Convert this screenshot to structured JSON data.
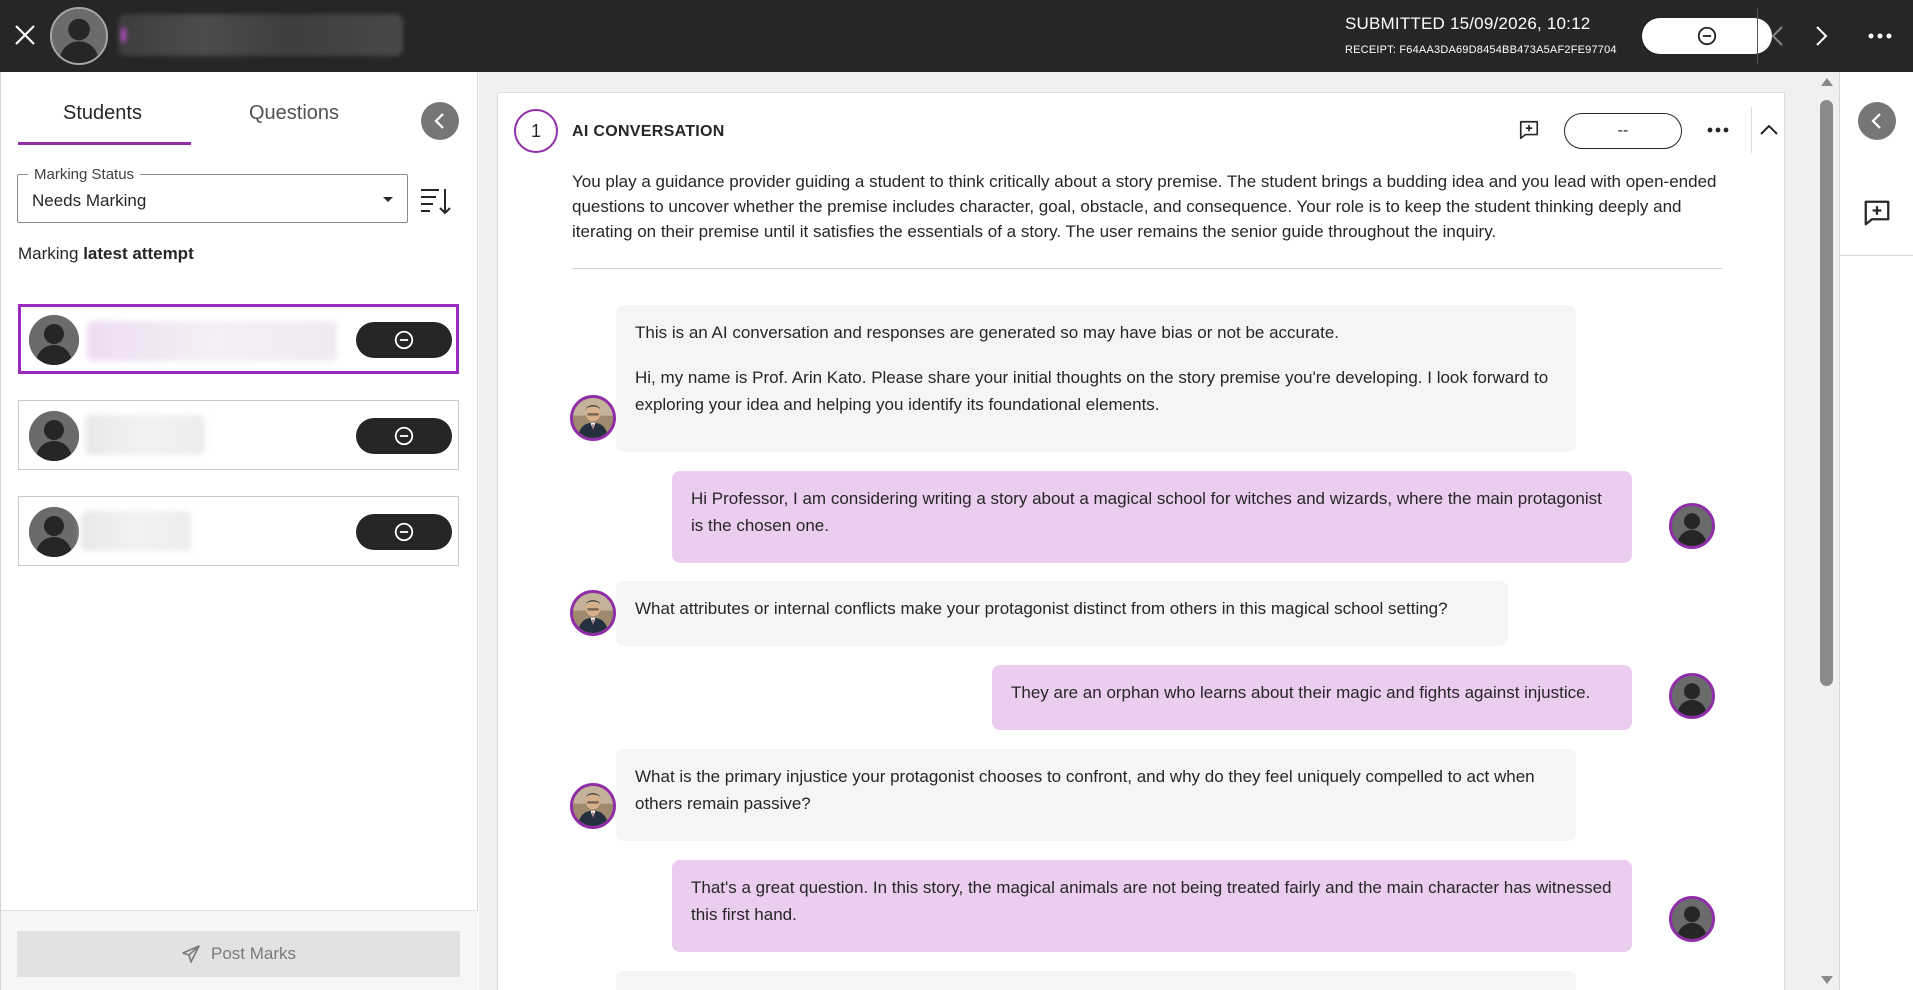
{
  "header": {
    "submitted": "SUBMITTED 15/09/2026, 10:12",
    "receipt": "RECEIPT: F64AA3DA69D8454BB473A5AF2FE97704"
  },
  "left": {
    "tabs": [
      "Students",
      "Questions"
    ],
    "marking_status_label": "Marking Status",
    "marking_status_value": "Needs Marking",
    "marking_prefix": "Marking",
    "marking_bold": "latest attempt",
    "post_marks": "Post Marks"
  },
  "question": {
    "number": "1",
    "title": "AI CONVERSATION",
    "score": "--",
    "description": "You play a guidance provider guiding a student to think critically about a story premise. The student brings a budding idea and you lead with open-ended questions to uncover whether the premise includes character, goal, obstacle, and consequence. Your role is to keep the student thinking deeply and iterating on their premise until it satisfies the essentials of a story. The user remains the senior guide throughout the inquiry."
  },
  "messages": [
    {
      "role": "ai",
      "text1": "This is an AI conversation and responses are generated so may have bias or not be accurate.",
      "text2": "Hi, my name is Prof. Arin Kato. Please share your initial thoughts on the story premise you're developing. I look forward to exploring your idea and helping you identify its foundational elements."
    },
    {
      "role": "user",
      "text": "Hi Professor, I am considering writing a story about a magical school for witches and wizards, where the main protagonist is the chosen one."
    },
    {
      "role": "ai",
      "text": "What attributes or internal conflicts make your protagonist distinct from others in this magical school setting?"
    },
    {
      "role": "user",
      "text": "They are an orphan who learns about their magic and fights against injustice."
    },
    {
      "role": "ai",
      "text": "What is the primary injustice your protagonist chooses to confront, and why do they feel uniquely compelled to act when others remain passive?"
    },
    {
      "role": "user",
      "text": "That's a great question. In this story, the magical animals are not being treated fairly and the main character has witnessed this first hand."
    }
  ],
  "icons": {
    "close": "close-icon",
    "grade": "minus-circle-icon",
    "prev": "chevron-left-icon",
    "next": "chevron-right-icon",
    "more": "more-horizontal-icon",
    "sort": "sort-icon",
    "feedback": "add-comment-icon",
    "collapse": "chevron-up-icon",
    "send": "send-icon"
  },
  "colors": {
    "topbar": "#262626",
    "accent": "#8f2ea8",
    "user_bubble": "#ebcdf0",
    "ai_bubble": "#f5f5f5"
  }
}
